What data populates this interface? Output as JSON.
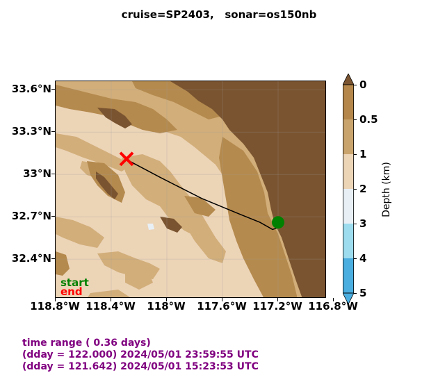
{
  "title": "cruise=SP2403,   sonar=os150nb",
  "map": {
    "lat_ticks": [
      {
        "label": "33.6°N",
        "value": 33.6
      },
      {
        "label": "33.3°N",
        "value": 33.3
      },
      {
        "label": "33°N",
        "value": 33.0
      },
      {
        "label": "32.7°N",
        "value": 32.7
      },
      {
        "label": "32.4°N",
        "value": 32.4
      }
    ],
    "lon_ticks": [
      {
        "label": "118.8°W",
        "value": -118.8
      },
      {
        "label": "118.4°W",
        "value": -118.4
      },
      {
        "label": "118°W",
        "value": -118.0
      },
      {
        "label": "117.6°W",
        "value": -117.6
      },
      {
        "label": "117.2°W",
        "value": -117.2
      },
      {
        "label": "116.8°W",
        "value": -116.8
      }
    ],
    "extent": {
      "lon_min": -118.8,
      "lon_max": -116.85,
      "lat_min": 32.12,
      "lat_max": 33.66
    },
    "track": [
      [
        -118.28,
        33.1
      ],
      [
        -118.05,
        32.98
      ],
      [
        -117.75,
        32.83
      ],
      [
        -117.48,
        32.72
      ],
      [
        -117.33,
        32.66
      ],
      [
        -117.24,
        32.61
      ],
      [
        -117.21,
        32.62
      ],
      [
        -117.2,
        32.66
      ]
    ],
    "start_marker": {
      "lon": -117.2,
      "lat": 32.66,
      "color": "#008000"
    },
    "end_marker": {
      "lon": -118.29,
      "lat": 33.11,
      "color": "#ff0000"
    },
    "legend": {
      "start": "start",
      "end": "end"
    }
  },
  "colorbar": {
    "title": "Depth (km)",
    "ticks": [
      "0",
      "0.5",
      "1",
      "2",
      "3",
      "4",
      "5"
    ],
    "colors": [
      "#b5874a",
      "#c9a46c",
      "#ecd4b7",
      "#e8f0f6",
      "#9ddcef",
      "#4aaee0"
    ],
    "over_color": "#7a5430",
    "under_color": "#4aaee0"
  },
  "footer": {
    "line1": "time range ( 0.36 days)",
    "line2": "(dday = 122.000) 2024/05/01 23:59:55 UTC",
    "line3": "(dday = 121.642) 2024/05/01 15:23:53 UTC"
  }
}
